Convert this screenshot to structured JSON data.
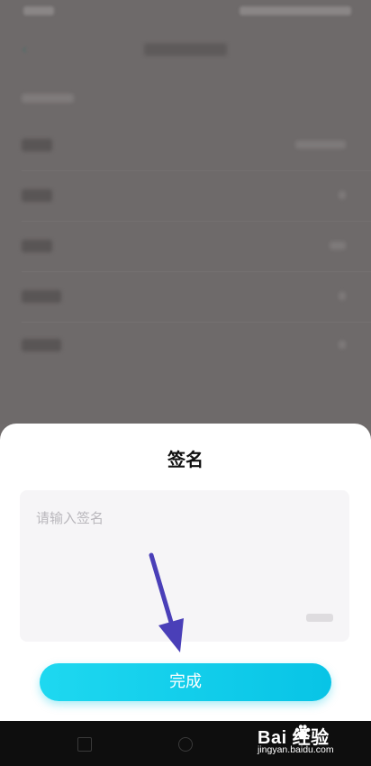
{
  "sheet": {
    "title": "签名",
    "signature_placeholder": "请输入签名",
    "done_label": "完成"
  },
  "watermark": {
    "logo_text": "Bai  经验",
    "site": "jingyan.baidu.com"
  },
  "colors": {
    "accent": "#12cfe9",
    "annotation_arrow": "#4a3fb8",
    "dim_overlay": "#6e6a6a"
  },
  "icons": [
    "back-arrow-icon",
    "baidu-paw-icon"
  ]
}
